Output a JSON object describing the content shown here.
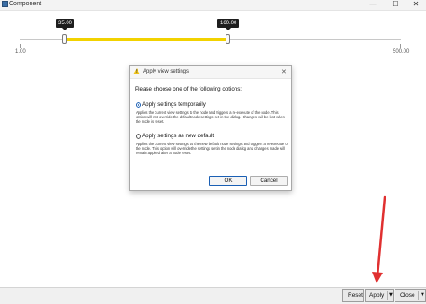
{
  "window": {
    "title": "Component",
    "minimize_glyph": "—",
    "maximize_glyph": "☐",
    "close_glyph": "✕"
  },
  "slider": {
    "min_label": "1.00",
    "max_label": "500.00",
    "min": 1.0,
    "max": 500.0,
    "low_value": 35.0,
    "high_value": 160.0,
    "low_tooltip": "35.00",
    "high_tooltip": "160.00",
    "fill_color": "#f2d200"
  },
  "dialog": {
    "title": "Apply view settings",
    "close_glyph": "✕",
    "prompt": "Please choose one of the following options:",
    "options": [
      {
        "label": "Apply settings temporarily",
        "selected": true,
        "description": "Applies the current view settings to the node and triggers a re-execute of the node. This option will not override the default node settings set in the dialog. Changes will be lost when the node is reset."
      },
      {
        "label": "Apply settings as new default",
        "selected": false,
        "description": "Applies the current view settings as the new default node settings and triggers a re-execute of the node. This option will override the settings set in the node dialog and changes made will remain applied after a node reset."
      }
    ],
    "ok_label": "OK",
    "cancel_label": "Cancel"
  },
  "bottom_bar": {
    "reset_label": "Reset",
    "apply_label": "Apply",
    "close_label": "Close",
    "caret_glyph": "▼"
  },
  "annotation": {
    "arrow_color": "#e03030"
  }
}
